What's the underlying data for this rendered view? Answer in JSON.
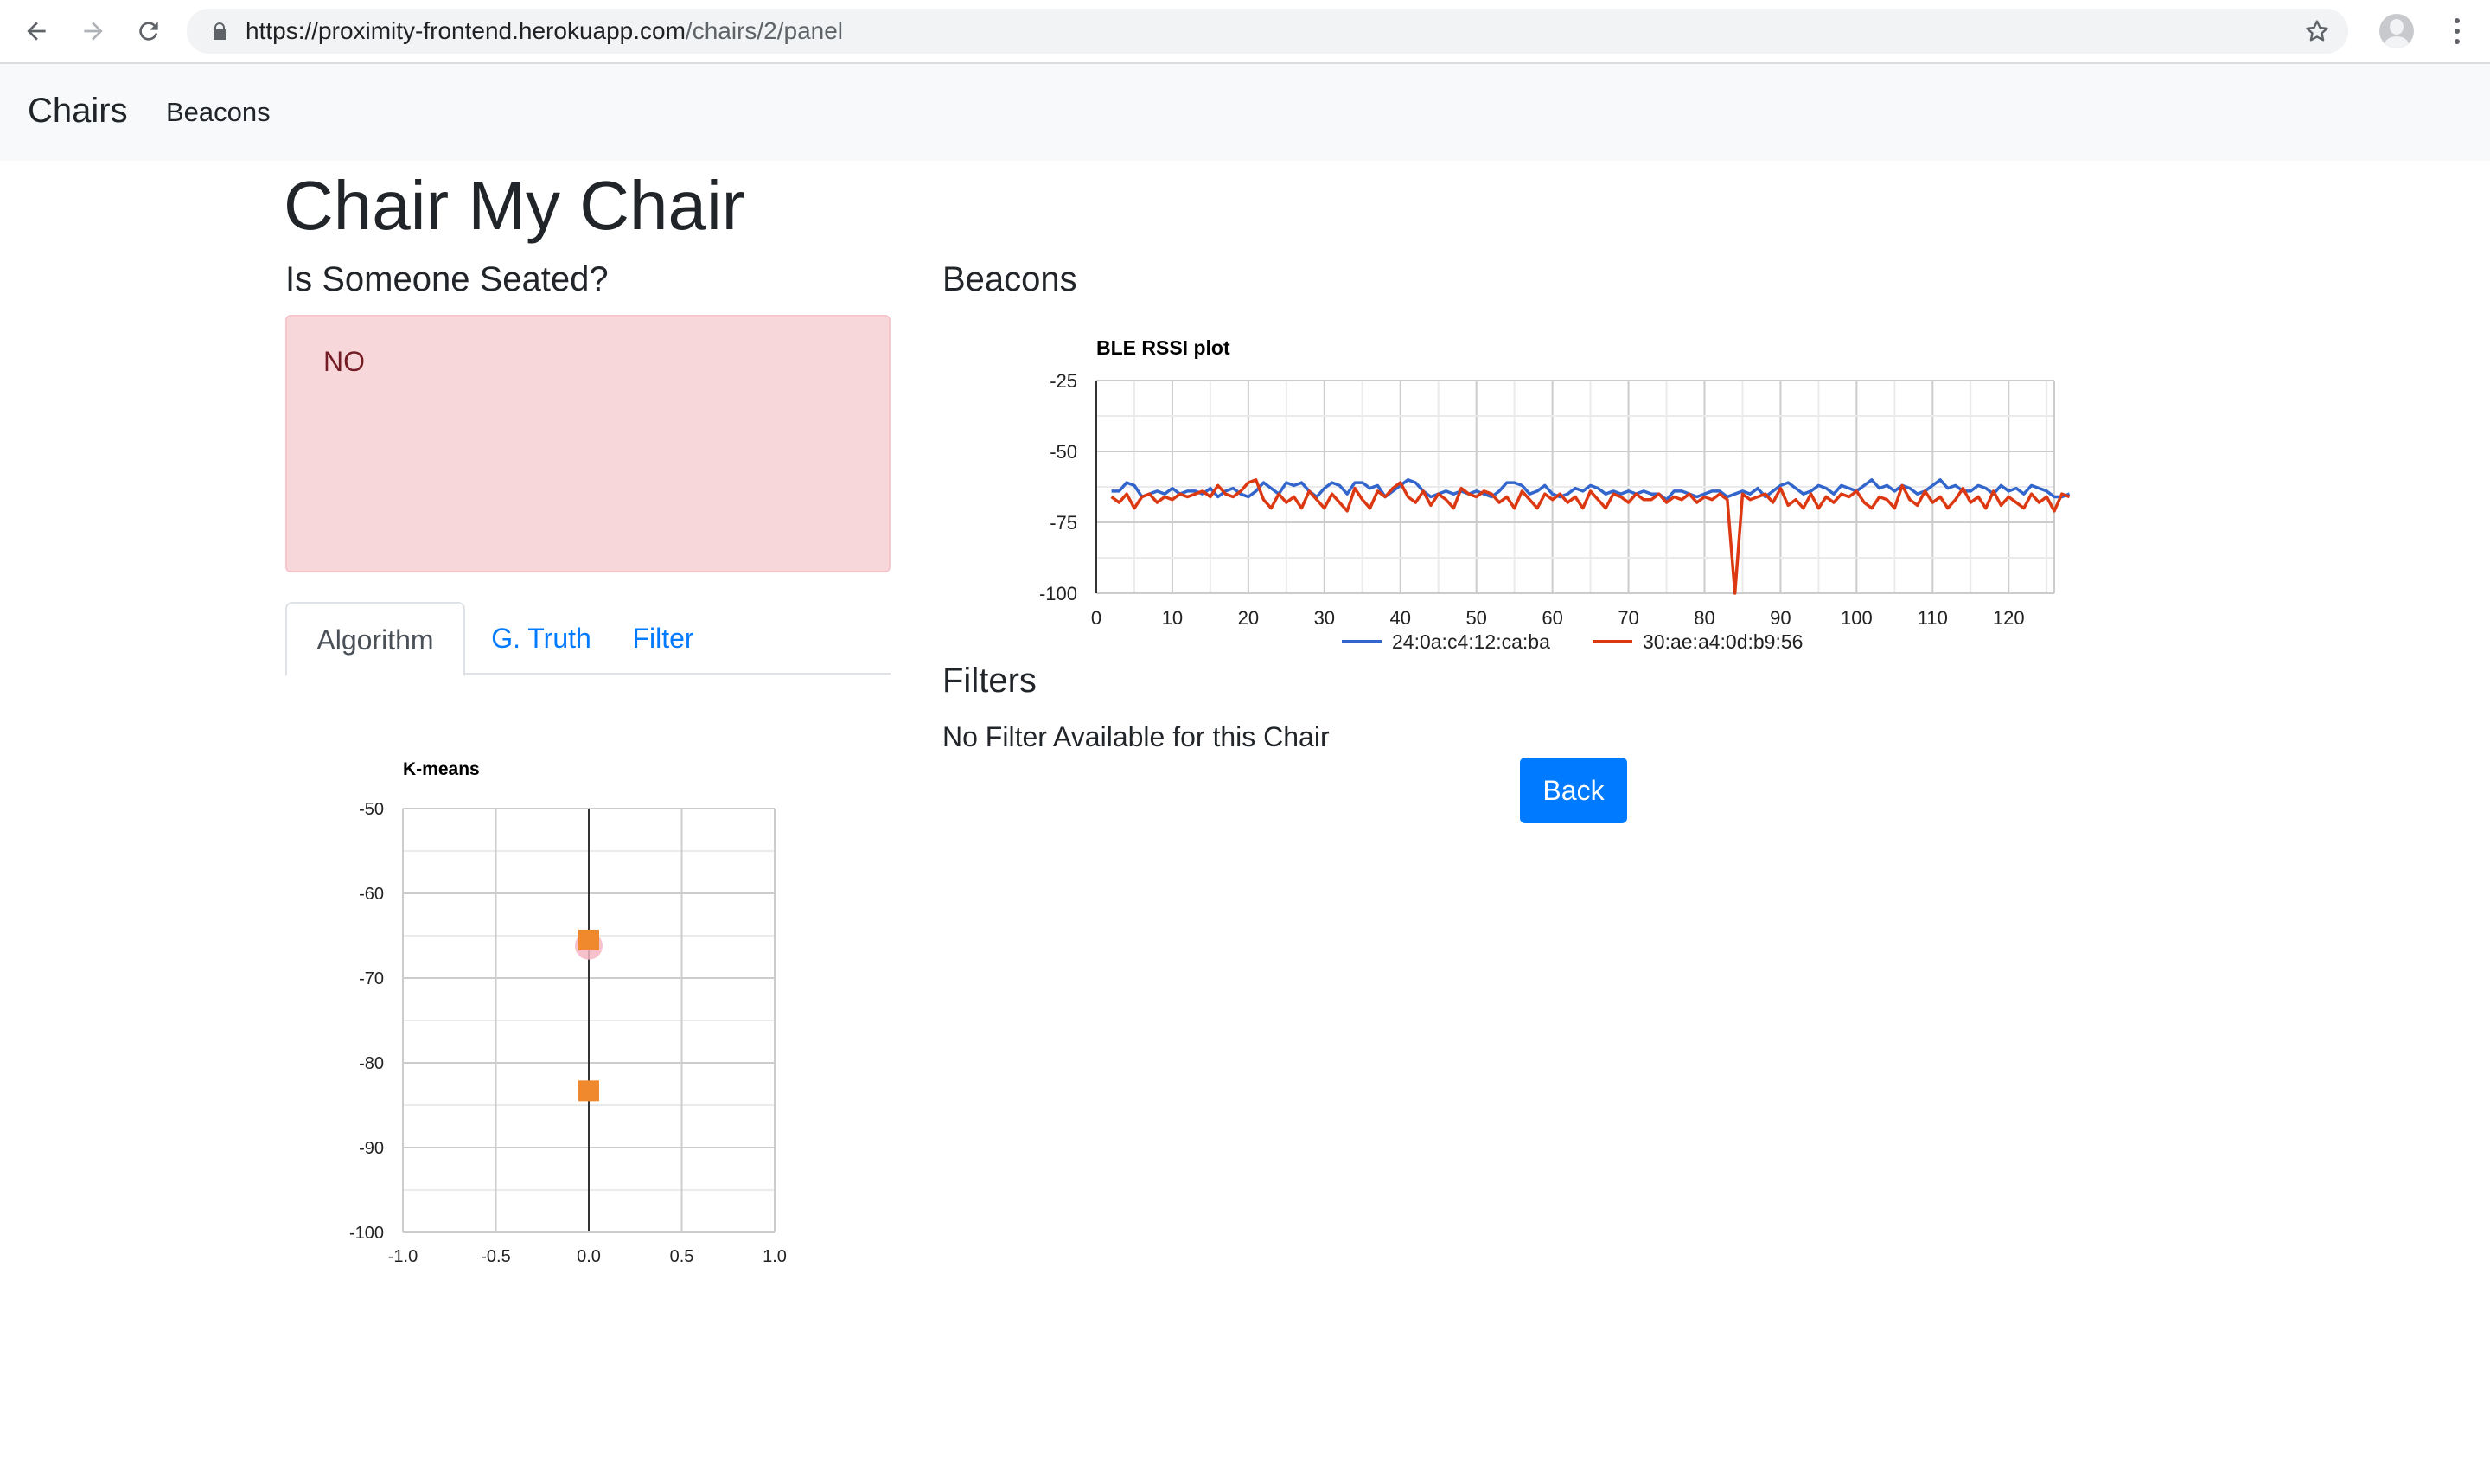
{
  "browser": {
    "url_host": "https://proximity-frontend.herokuapp.com",
    "url_path": "/chairs/2/panel",
    "icons": [
      "back-arrow-icon",
      "forward-arrow-icon",
      "reload-icon",
      "lock-icon",
      "star-icon",
      "profile-avatar",
      "more-vert-icon"
    ]
  },
  "navbar": {
    "brand": "Chairs",
    "links": [
      "Beacons"
    ]
  },
  "page": {
    "title": "Chair My Chair",
    "seated_heading": "Is Someone Seated?",
    "seated_status": "NO",
    "tabs": [
      {
        "label": "Algorithm",
        "active": true
      },
      {
        "label": "G. Truth",
        "active": false
      },
      {
        "label": "Filter",
        "active": false
      }
    ],
    "beacons_heading": "Beacons",
    "filters_heading": "Filters",
    "no_filter_text": "No Filter Available for this Chair",
    "back_button": "Back"
  },
  "colors": {
    "alert_bg": "#f8d7da",
    "alert_text": "#721c24",
    "link": "#007bff",
    "primary_button": "#007bff",
    "series_blue": "#3366cc",
    "series_red": "#dc3912",
    "kmeans_marker": "#f0892e"
  },
  "chart_data": [
    {
      "type": "line",
      "title": "BLE RSSI plot",
      "xlabel": "",
      "ylabel": "",
      "xlim": [
        0,
        126
      ],
      "ylim": [
        -100,
        -25
      ],
      "x_ticks": [
        0,
        10,
        20,
        30,
        40,
        50,
        60,
        70,
        80,
        90,
        100,
        110,
        120
      ],
      "y_ticks": [
        -25,
        -50,
        -75,
        -100
      ],
      "grid": true,
      "legend": "bottom",
      "series": [
        {
          "name": "24:0a:c4:12:ca:ba",
          "color": "#3366cc",
          "values": [
            -64,
            -64,
            -61,
            -62,
            -66,
            -65,
            -64,
            -65,
            -63,
            -65,
            -64,
            -64,
            -65,
            -63,
            -66,
            -64,
            -63,
            -65,
            -66,
            -64,
            -61,
            -63,
            -65,
            -61,
            -62,
            -61,
            -64,
            -66,
            -63,
            -61,
            -62,
            -65,
            -61,
            -61,
            -63,
            -62,
            -66,
            -64,
            -62,
            -60,
            -61,
            -64,
            -66,
            -65,
            -64,
            -65,
            -64,
            -65,
            -64,
            -65,
            -66,
            -64,
            -61,
            -61,
            -62,
            -65,
            -64,
            -62,
            -65,
            -66,
            -65,
            -63,
            -64,
            -62,
            -63,
            -65,
            -64,
            -65,
            -64,
            -65,
            -64,
            -65,
            -65,
            -67,
            -64,
            -64,
            -65,
            -66,
            -65,
            -64,
            -64,
            -66,
            -65,
            -64,
            -65,
            -63,
            -66,
            -64,
            -62,
            -61,
            -63,
            -65,
            -64,
            -62,
            -63,
            -65,
            -62,
            -63,
            -64,
            -62,
            -60,
            -63,
            -62,
            -64,
            -62,
            -63,
            -65,
            -64,
            -62,
            -60,
            -63,
            -62,
            -64,
            -64,
            -62,
            -63,
            -65,
            -62,
            -64,
            -63,
            -65,
            -62,
            -63,
            -64,
            -66,
            -66,
            -65
          ]
        },
        {
          "name": "30:ae:a4:0d:b9:56",
          "color": "#dc3912",
          "values": [
            -66,
            -68,
            -65,
            -70,
            -66,
            -65,
            -68,
            -66,
            -67,
            -65,
            -66,
            -65,
            -64,
            -66,
            -62,
            -65,
            -66,
            -64,
            -61,
            -60,
            -67,
            -70,
            -65,
            -68,
            -66,
            -70,
            -64,
            -67,
            -70,
            -65,
            -68,
            -71,
            -63,
            -67,
            -70,
            -64,
            -66,
            -63,
            -61,
            -66,
            -68,
            -64,
            -69,
            -65,
            -67,
            -70,
            -63,
            -65,
            -66,
            -64,
            -65,
            -68,
            -66,
            -70,
            -64,
            -67,
            -70,
            -65,
            -67,
            -65,
            -68,
            -66,
            -70,
            -64,
            -67,
            -70,
            -65,
            -66,
            -68,
            -65,
            -67,
            -67,
            -65,
            -68,
            -66,
            -67,
            -65,
            -68,
            -66,
            -67,
            -65,
            -67,
            -100,
            -65,
            -67,
            -66,
            -65,
            -68,
            -63,
            -69,
            -67,
            -70,
            -65,
            -70,
            -66,
            -68,
            -65,
            -66,
            -64,
            -68,
            -70,
            -66,
            -67,
            -70,
            -62,
            -67,
            -69,
            -64,
            -68,
            -66,
            -70,
            -67,
            -63,
            -68,
            -66,
            -70,
            -64,
            -69,
            -66,
            -68,
            -70,
            -65,
            -68,
            -66,
            -71,
            -65,
            -66
          ]
        }
      ]
    },
    {
      "type": "scatter",
      "title": "K-means",
      "xlabel": "",
      "ylabel": "",
      "xlim": [
        -1.0,
        1.0
      ],
      "ylim": [
        -100,
        -50
      ],
      "x_ticks": [
        "-1.0",
        "-0.5",
        "0.0",
        "0.5",
        "1.0"
      ],
      "y_ticks": [
        -50,
        -60,
        -70,
        -80,
        -90,
        -100
      ],
      "grid": true,
      "series": [
        {
          "color": "#f0892e",
          "marker": "square",
          "points": [
            {
              "x": 0.0,
              "y": -65.5
            },
            {
              "x": 0.0,
              "y": -83.3
            }
          ]
        },
        {
          "color": "#f4b6c2",
          "marker": "circle",
          "points": [
            {
              "x": 0.0,
              "y": -66.2
            }
          ]
        }
      ]
    }
  ]
}
